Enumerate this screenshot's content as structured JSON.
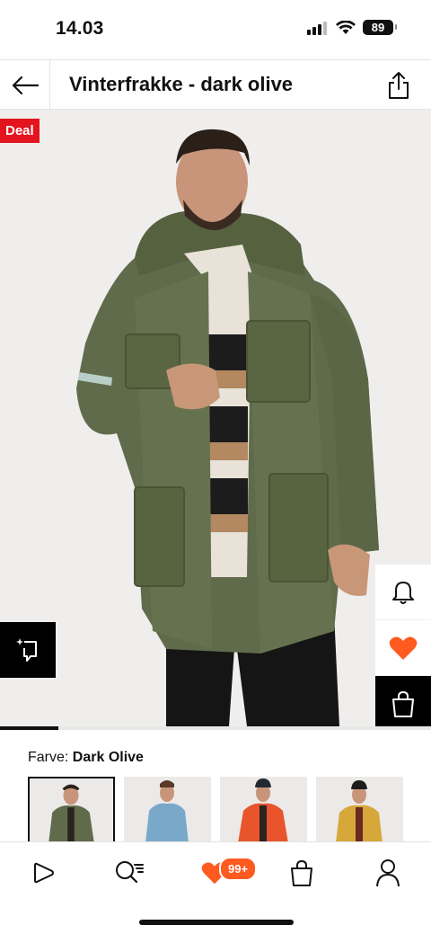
{
  "status_bar": {
    "time": "14.03",
    "battery": "89"
  },
  "header": {
    "title": "Vinterfrakke - dark olive"
  },
  "product": {
    "badge": "Deal",
    "color_label": "Farve:",
    "color_value": "Dark Olive",
    "image_progress": 0.135,
    "variants": [
      {
        "name": "Dark Olive",
        "color": "#5f6b4b",
        "selected": true
      },
      {
        "name": "Blue",
        "color": "#7aa8c8",
        "selected": false
      },
      {
        "name": "Orange",
        "color": "#e8552d",
        "selected": false
      },
      {
        "name": "Yellow",
        "color": "#d6a83a",
        "selected": false
      }
    ]
  },
  "bottom_nav": {
    "wishlist_badge": "99+"
  },
  "colors": {
    "accent": "#ff5a1f",
    "deal": "#e4141e",
    "favorite": "#ff5a1f"
  }
}
